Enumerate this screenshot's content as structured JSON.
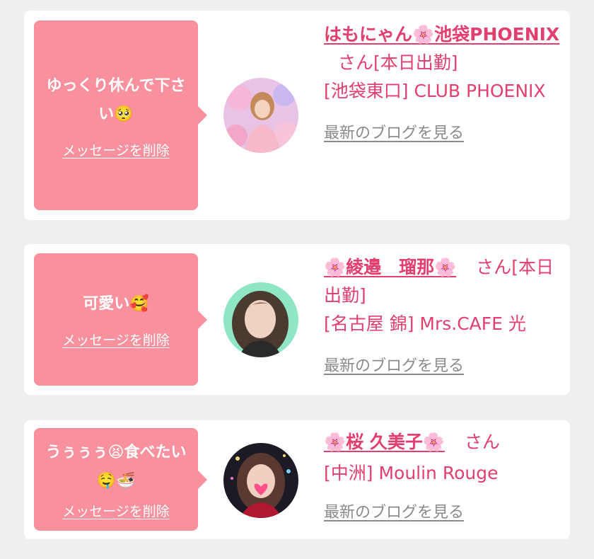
{
  "cards": [
    {
      "message": "ゆっくり休んで下さい🥺",
      "delete_label": "メッセージを削除",
      "name": "はもにゃん🌸池袋PHOENIX",
      "honorific": "さん",
      "status": "[本日出勤]",
      "shop": "[池袋東口] CLUB PHOENIX",
      "blog_label": "最新のブログを見る"
    },
    {
      "message": "可愛い🥰",
      "delete_label": "メッセージを削除",
      "name": "🌸綾邉　瑠那🌸",
      "honorific": "さん",
      "status": "[本日出勤]",
      "shop": "[名古屋 錦] Mrs.CAFE 光",
      "blog_label": "最新のブログを見る"
    },
    {
      "message": "うぅぅぅ😫食べたい🤤🍜",
      "delete_label": "メッセージを削除",
      "name": "🌸桜 久美子🌸",
      "honorific": "さん",
      "status": "",
      "shop": "[中洲] Moulin Rouge",
      "blog_label": "最新のブログを見る"
    }
  ],
  "colors": {
    "page_bg": "#efeff0",
    "bubble": "#f8919d",
    "name": "#e23f6f",
    "link_gray": "#8a8a8a"
  }
}
